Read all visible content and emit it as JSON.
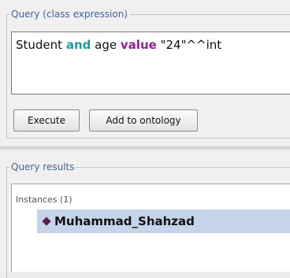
{
  "query_panel": {
    "title": "Query (class expression)",
    "expression": {
      "class_name": "Student",
      "keyword_and": "and",
      "property": "age",
      "keyword_value": "value",
      "literal": "\"24\"^^int"
    },
    "buttons": {
      "execute": "Execute",
      "add_to_ontology": "Add to ontology"
    }
  },
  "results_panel": {
    "title": "Query results",
    "section_header": "Instances (1)",
    "items": [
      {
        "label": "Muhammad_Shahzad",
        "icon": "individual-diamond-icon"
      }
    ]
  },
  "colors": {
    "group_title": "#3a65a8",
    "keyword_and": "#18a0a0",
    "keyword_value": "#9a1aa0",
    "selection": "#c5d4e8",
    "individual_icon": "#5a1f4e"
  }
}
